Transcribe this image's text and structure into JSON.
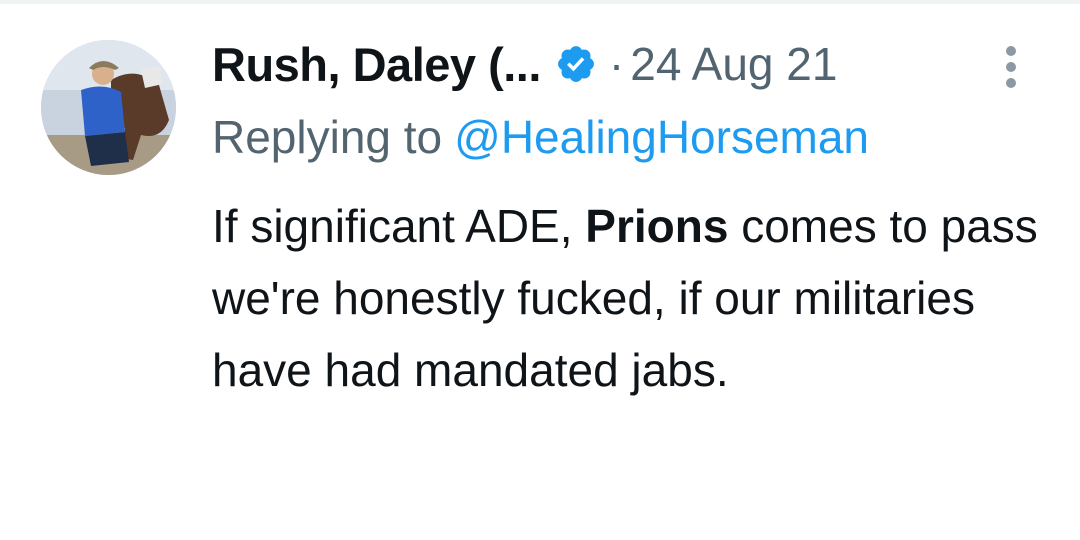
{
  "tweet": {
    "display_name": "Rush, Daley (...",
    "verified": true,
    "separator": "·",
    "timestamp": "24 Aug 21",
    "replying_prefix": "Replying to",
    "replying_handle": "@HealingHorseman",
    "text_part1": "If significant ADE, ",
    "text_bold": "Prions",
    "text_part2": " comes to pass we're honestly fucked, if our militaries have had mandated jabs."
  },
  "icons": {
    "verified": "verified-badge-icon",
    "more": "more-vertical-icon"
  },
  "colors": {
    "text_primary": "#0f1419",
    "text_secondary": "#536471",
    "accent": "#1d9bf0"
  }
}
